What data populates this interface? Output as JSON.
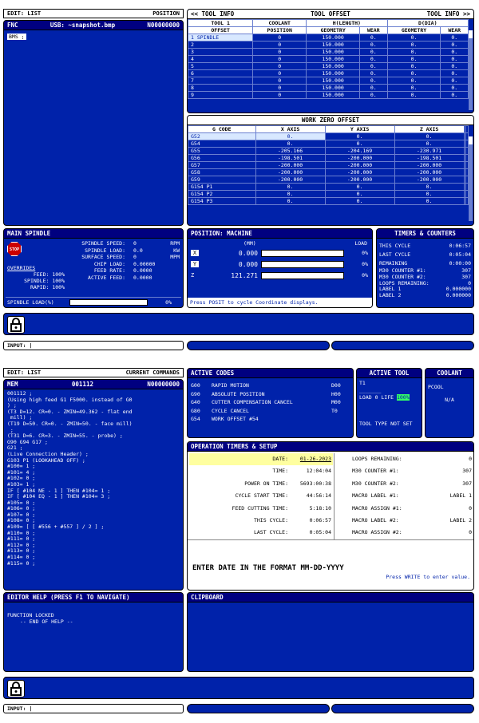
{
  "s1": {
    "edit": {
      "left": "EDIT: LIST",
      "right": "POSITION"
    },
    "fnc": {
      "left": "FNC",
      "mid": "USB: ~snapshot.bmp",
      "right": "N00000000"
    },
    "prog_line": "BMS ;",
    "tool_info": {
      "left": "<< TOOL INFO",
      "mid": "TOOL OFFSET",
      "right": "TOOL INFO >>",
      "h_tool": "TOOL  1",
      "h_coolant": "COOLANT",
      "h_hl": "H(LENGTH)",
      "h_dd": "D(DIA)",
      "h_offset": "OFFSET",
      "h_position": "POSITION",
      "h_geo": "GEOMETRY",
      "h_wear": "WEAR",
      "h_geo2": "GEOMETRY",
      "h_wear2": "WEAR",
      "rows": [
        [
          "1 SPINDLE",
          "0",
          "150.000",
          "0.",
          "0.",
          "0."
        ],
        [
          "2",
          "0",
          "150.000",
          "0.",
          "0.",
          "0."
        ],
        [
          "3",
          "0",
          "150.000",
          "0.",
          "0.",
          "0."
        ],
        [
          "4",
          "0",
          "150.000",
          "0.",
          "0.",
          "0."
        ],
        [
          "5",
          "0",
          "150.000",
          "0.",
          "0.",
          "0."
        ],
        [
          "6",
          "0",
          "150.000",
          "0.",
          "0.",
          "0."
        ],
        [
          "7",
          "0",
          "150.000",
          "0.",
          "0.",
          "0."
        ],
        [
          "8",
          "0",
          "150.000",
          "0.",
          "0.",
          "0."
        ],
        [
          "9",
          "0",
          "150.000",
          "0.",
          "0.",
          "0."
        ]
      ]
    },
    "work": {
      "title": "WORK ZERO OFFSET",
      "h": [
        "G CODE",
        "X AXIS",
        "Y AXIS",
        "Z AXIS"
      ],
      "rows": [
        [
          "G52",
          "0.",
          "0.",
          "0."
        ],
        [
          "G54",
          "0.",
          "0.",
          "0."
        ],
        [
          "G55",
          "-205.166",
          "-204.169",
          "-230.971"
        ],
        [
          "G56",
          "-198.501",
          "-200.000",
          "-198.501"
        ],
        [
          "G57",
          "-200.000",
          "-200.000",
          "-200.000"
        ],
        [
          "G58",
          "-200.000",
          "-200.000",
          "-200.000"
        ],
        [
          "G59",
          "-200.000",
          "-200.000",
          "-200.000"
        ],
        [
          "G154 P1",
          "0.",
          "0.",
          "0."
        ],
        [
          "G154 P2",
          "0.",
          "0.",
          "0."
        ],
        [
          "G154 P3",
          "0.",
          "0.",
          "0."
        ]
      ]
    },
    "spindle": {
      "title": "MAIN SPINDLE",
      "stop": "STOP",
      "labels": [
        "SPINDLE SPEED:",
        "SPINDLE LOAD:",
        "SURFACE SPEED:",
        "CHIP LOAD:",
        "FEED RATE:",
        "ACTIVE FEED:"
      ],
      "vals": [
        "0",
        "0.0",
        "0",
        "0.00000",
        "0.0000",
        "0.0000"
      ],
      "units": [
        "RPM",
        "KW",
        "MPM",
        "",
        "",
        ""
      ],
      "overrides": "OVERRIDES",
      "feed": "FEED: 100%",
      "spin": "SPINDLE: 100%",
      "rapid": "RAPID: 100%",
      "load_label": "SPINDLE LOAD(%)",
      "load_val": "0%"
    },
    "position": {
      "title": "POSITION: MACHINE",
      "unit": "(MM)",
      "load": "LOAD",
      "axes": [
        {
          "a": "X",
          "v": "0.000",
          "l": "0%"
        },
        {
          "a": "Y",
          "v": "0.000",
          "l": "0%"
        },
        {
          "a": "Z",
          "v": "121.271",
          "l": "0%"
        }
      ],
      "hint": "Press POSIT to cycle Coordinate displays."
    },
    "timers": {
      "title": "TIMERS & COUNTERS",
      "rows": [
        [
          "THIS CYCLE",
          "0:06:57"
        ],
        [
          "LAST CYCLE",
          "0:05:04"
        ],
        [
          "REMAINING",
          "0:00:00"
        ],
        [
          "M30 COUNTER #1:",
          "307"
        ],
        [
          "M30 COUNTER #2:",
          "307"
        ],
        [
          "LOOPS REMAINING:",
          "0"
        ],
        [
          "LABEL 1",
          "0.000000"
        ],
        [
          "LABEL 2",
          "0.000000"
        ]
      ]
    },
    "input": "INPUT: |"
  },
  "s2": {
    "edit": {
      "left": "EDIT: LIST",
      "right": "CURRENT COMMANDS"
    },
    "mem": {
      "left": "MEM",
      "mid": "001112",
      "right": "N00000000"
    },
    "code": "001112 ;\n(Using high feed G1 F5000. instead of G0\n) ;\n(T3 D=12. CR=0. - ZMIN=49.362 - flat end\n mill) ;\n(T19 D=50. CR=0. - ZMIN=50. - face mill)\n ;\n(T31 D=6. CR=3. - ZMIN=55. - probe) ;\nG90 G94 G17 ;\nG21 ;\n(Live Connection Header) ;\nG103 P1 (LOOKAHEAD OFF) ;\n#100= 1 ;\n#101= 4 ;\n#102= 0 ;\n#103= 1 ;\nIF [ #104 NE - 1 ] THEN #104= 1 ;\nIF [ #104 EQ - 1 ] THEN #104= 3 ;\n#105= 0 ;\n#106= 0 ;\n#107= 0 ;\n#108= 0 ;\n#109= [ [ #556 + #557 ] / 2 ] ;\n#110= 0 ;\n#111= 0 ;\n#112= 0 ;\n#113= 0 ;\n#114= 0 ;\n#115= 0 ;",
    "active": {
      "title": "ACTIVE CODES",
      "rows": [
        [
          "G00",
          "RAPID MOTION",
          "D00"
        ],
        [
          "G90",
          "ABSOLUTE POSITION",
          "H00"
        ],
        [
          "G40",
          "CUTTER COMPENSATION CANCEL",
          "M00"
        ],
        [
          "G80",
          "CYCLE CANCEL",
          "T0"
        ],
        [
          "G54",
          "WORK OFFSET #54",
          ""
        ]
      ]
    },
    "tool": {
      "title": "ACTIVE TOOL",
      "t": "T1",
      "load": "LOAD 0  LIFE",
      "life": "100%",
      "type": "TOOL TYPE NOT SET"
    },
    "coolant": {
      "title": "COOLANT",
      "pcool": "PCOOL",
      "na": "N/A"
    },
    "ops": {
      "title": "OPERATION TIMERS & SETUP",
      "left": [
        [
          "DATE:",
          "01-26-2023"
        ],
        [
          "TIME:",
          "12:04:04"
        ],
        [
          "POWER ON TIME:",
          "5693:00:38"
        ],
        [
          "CYCLE START TIME:",
          "44:56:14"
        ],
        [
          "FEED CUTTING TIME:",
          "5:18:10"
        ],
        [
          "THIS CYCLE:",
          "0:06:57"
        ],
        [
          "LAST CYCLE:",
          "0:05:04"
        ]
      ],
      "right": [
        [
          "LOOPS REMAINING:",
          "0"
        ],
        [
          "M30 COUNTER #1:",
          "307"
        ],
        [
          "M30 COUNTER #2:",
          "307"
        ],
        [
          "MACRO LABEL #1:",
          "LABEL 1"
        ],
        [
          "MACRO ASSIGN #1:",
          "0"
        ],
        [
          "MACRO LABEL #2:",
          "LABEL 2"
        ],
        [
          "MACRO ASSIGN #2:",
          "0"
        ]
      ],
      "prompt": "ENTER DATE IN THE FORMAT MM-DD-YYYY",
      "sub": "Press WRITE to enter value."
    },
    "help": {
      "title": "EDITOR HELP (PRESS F1 TO NAVIGATE)",
      "l1": "FUNCTION LOCKED",
      "l2": "-- END OF HELP --"
    },
    "clip": {
      "title": "CLIPBOARD"
    },
    "input": "INPUT: |"
  }
}
